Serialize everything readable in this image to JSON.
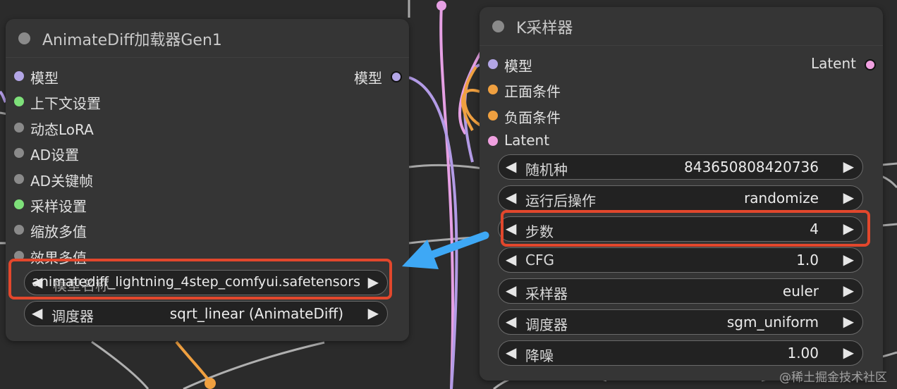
{
  "colors": {
    "canvas_bg": "#2b2b2b",
    "node_bg": "#353535",
    "highlight": "#e2472c",
    "callout_arrow": "#3ea8f5",
    "port_model": "#b3a6e6",
    "port_context": "#7ee07a",
    "port_gray": "#8a8a8a",
    "port_conditioning": "#f0a040",
    "port_latent": "#f0a0e0"
  },
  "left_node": {
    "title": "AnimateDiff加载器Gen1",
    "inputs": [
      {
        "label": "模型",
        "type": "model"
      },
      {
        "label": "上下文设置",
        "type": "context"
      },
      {
        "label": "动态LoRA",
        "type": "gray"
      },
      {
        "label": "AD设置",
        "type": "gray"
      },
      {
        "label": "AD关键帧",
        "type": "gray"
      },
      {
        "label": "采样设置",
        "type": "context"
      },
      {
        "label": "缩放多值",
        "type": "gray"
      },
      {
        "label": "效果多值",
        "type": "gray"
      }
    ],
    "output": {
      "label": "模型",
      "type": "model"
    },
    "widgets": [
      {
        "label": "模型名称",
        "value": "animatediff_lightning_4step_comfyui.safetensors",
        "highlighted": true
      },
      {
        "label": "调度器",
        "value": "sqrt_linear (AnimateDiff)",
        "highlighted": false
      }
    ]
  },
  "right_node": {
    "title": "K采样器",
    "inputs": [
      {
        "label": "模型",
        "type": "model"
      },
      {
        "label": "正面条件",
        "type": "conditioning"
      },
      {
        "label": "负面条件",
        "type": "conditioning"
      },
      {
        "label": "Latent",
        "type": "latent"
      }
    ],
    "output": {
      "label": "Latent",
      "type": "latent"
    },
    "widgets": [
      {
        "label": "随机种",
        "value": "843650808420736",
        "highlighted": false
      },
      {
        "label": "运行后操作",
        "value": "randomize",
        "highlighted": false
      },
      {
        "label": "步数",
        "value": "4",
        "highlighted": true
      },
      {
        "label": "CFG",
        "value": "1.0",
        "highlighted": false
      },
      {
        "label": "采样器",
        "value": "euler",
        "highlighted": false
      },
      {
        "label": "调度器",
        "value": "sgm_uniform",
        "highlighted": false
      },
      {
        "label": "降噪",
        "value": "1.00",
        "highlighted": false
      }
    ]
  },
  "watermark": "@稀土掘金技术社区"
}
